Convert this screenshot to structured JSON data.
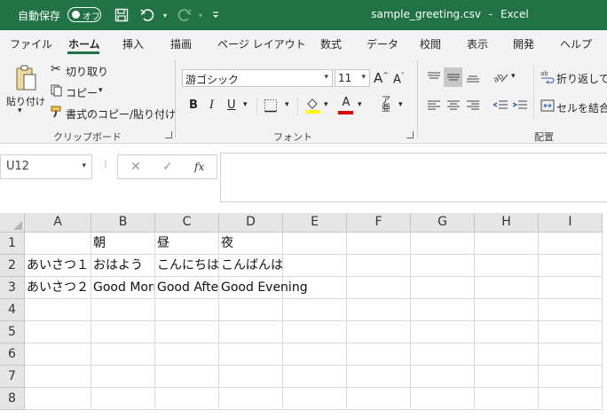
{
  "titlebar": {
    "autosave_label": "自動保存",
    "autosave_state": "オフ",
    "document_title": "sample_greeting.csv",
    "separator": "-",
    "app_name": "Excel"
  },
  "tabs": [
    {
      "label": "ファイル"
    },
    {
      "label": "ホーム"
    },
    {
      "label": "挿入"
    },
    {
      "label": "描画"
    },
    {
      "label": "ページ レイアウト"
    },
    {
      "label": "数式"
    },
    {
      "label": "データ"
    },
    {
      "label": "校閲"
    },
    {
      "label": "表示"
    },
    {
      "label": "開発"
    },
    {
      "label": "ヘルプ"
    }
  ],
  "ribbon": {
    "clipboard": {
      "paste": "貼り付け",
      "cut": "切り取り",
      "copy": "コピー",
      "format_painter": "書式のコピー/貼り付け",
      "group_label": "クリップボード"
    },
    "font": {
      "font_name": "游ゴシック",
      "font_size": "11",
      "bold": "B",
      "italic": "I",
      "underline": "U",
      "font_color_letter": "A",
      "group_label": "フォント"
    },
    "alignment": {
      "wrap_text": "折り返して全",
      "merge_center": "セルを結合し",
      "group_label": "配置"
    }
  },
  "formula_bar": {
    "name_box": "U12",
    "fx": "fx",
    "value": ""
  },
  "grid": {
    "columns": [
      "A",
      "B",
      "C",
      "D",
      "E",
      "F",
      "G",
      "H",
      "I"
    ],
    "rows": [
      "1",
      "2",
      "3",
      "4",
      "5",
      "6",
      "7",
      "8"
    ],
    "cells": [
      [
        "",
        "朝",
        "昼",
        "夜",
        "",
        "",
        "",
        "",
        ""
      ],
      [
        "あいさつ１",
        "おはよう",
        "こんにちは",
        "こんばんは",
        "",
        "",
        "",
        "",
        ""
      ],
      [
        "あいさつ２",
        "Good Morning",
        "Good Afternoon",
        "Good Evening",
        "",
        "",
        "",
        "",
        ""
      ],
      [
        "",
        "",
        "",
        "",
        "",
        "",
        "",
        "",
        ""
      ],
      [
        "",
        "",
        "",
        "",
        "",
        "",
        "",
        "",
        ""
      ],
      [
        "",
        "",
        "",
        "",
        "",
        "",
        "",
        "",
        ""
      ],
      [
        "",
        "",
        "",
        "",
        "",
        "",
        "",
        "",
        ""
      ],
      [
        "",
        "",
        "",
        "",
        "",
        "",
        "",
        "",
        ""
      ]
    ]
  },
  "colors": {
    "excel_green": "#217346",
    "ribbon_bg": "#f3f3f3",
    "header_bg": "#e6e6e6",
    "fill_yellow": "#ffff00",
    "font_red": "#e00000"
  }
}
